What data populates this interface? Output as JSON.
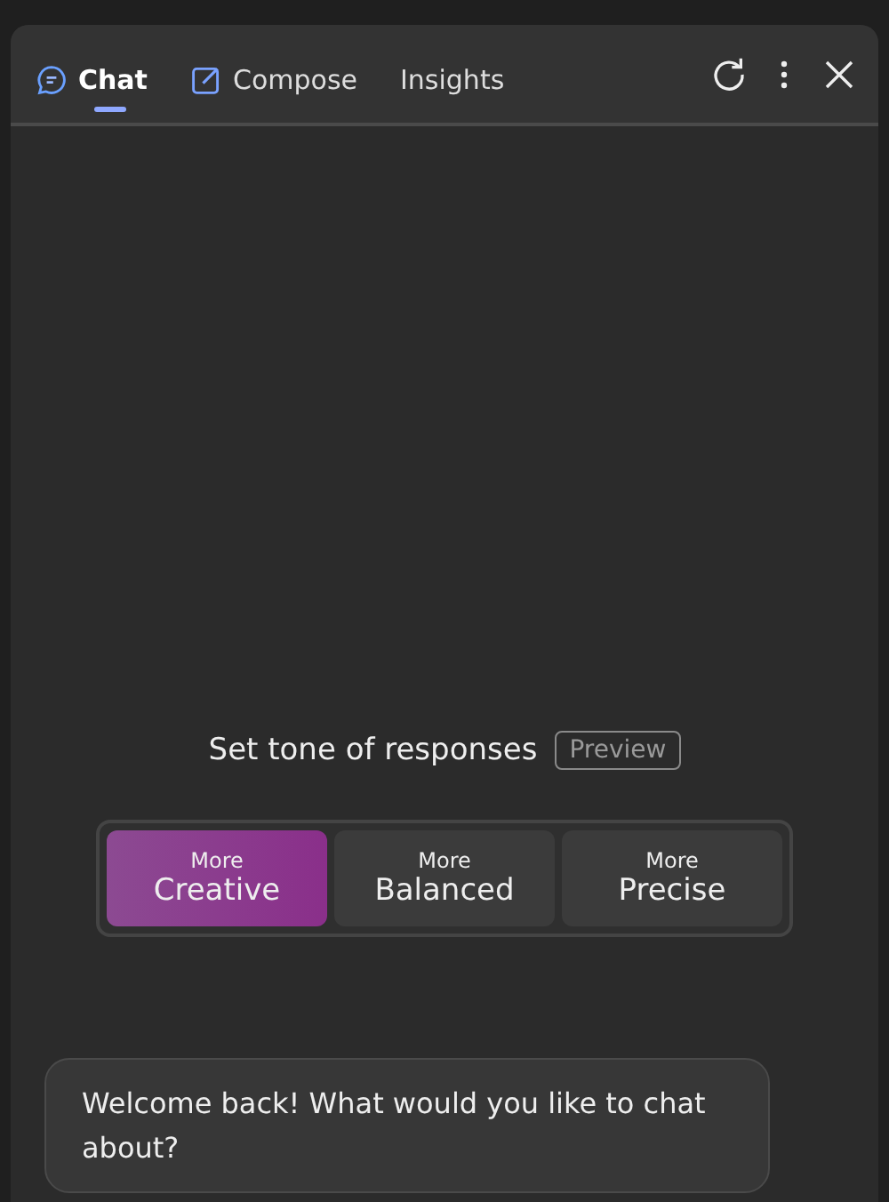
{
  "tabs": [
    {
      "label": "Chat",
      "kind": "chat",
      "selected": true
    },
    {
      "label": "Compose",
      "kind": "compose",
      "selected": false
    },
    {
      "label": "Insights",
      "kind": "plain",
      "selected": false
    }
  ],
  "tone": {
    "title": "Set tone of responses",
    "badge": "Preview",
    "options": [
      {
        "prefix": "More",
        "label": "Creative",
        "selected": true
      },
      {
        "prefix": "More",
        "label": "Balanced",
        "selected": false
      },
      {
        "prefix": "More",
        "label": "Precise",
        "selected": false
      }
    ]
  },
  "message": "Welcome back! What would you like to chat about?"
}
